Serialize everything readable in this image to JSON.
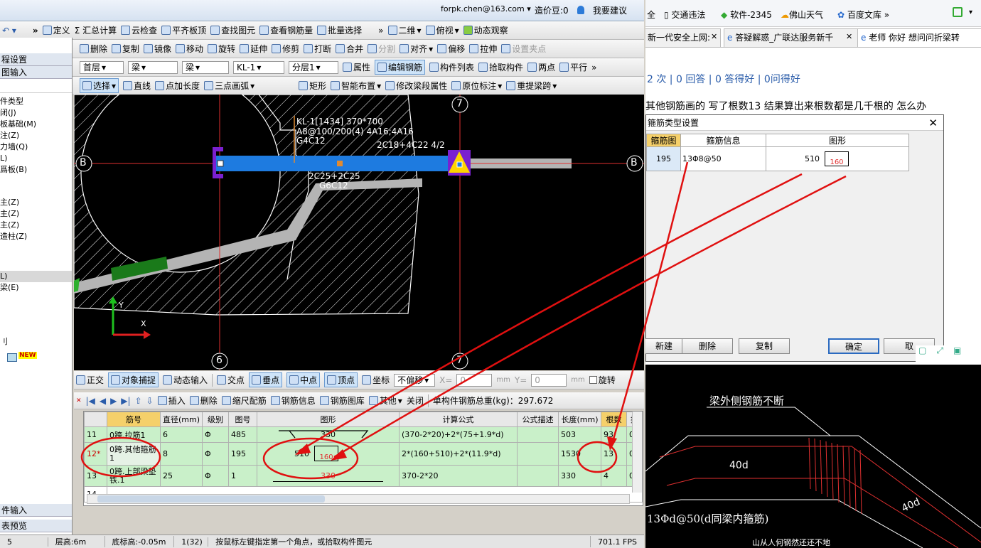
{
  "app": {
    "user": "forpk.chen@163.com",
    "cost_beans": "造价豆:0",
    "suggest": "我要建议"
  },
  "toolbar1": [
    "定义",
    "Σ 汇总计算",
    "云检查",
    "平齐板顶",
    "查找图元",
    "查看钢筋量",
    "批量选择"
  ],
  "view_bar": {
    "mode": "二维",
    "view": "俯视",
    "dynamic": "动态观察"
  },
  "toolbar2": [
    "删除",
    "复制",
    "镜像",
    "移动",
    "旋转",
    "延伸",
    "修剪",
    "打断",
    "合并",
    "分割",
    "对齐",
    "偏移",
    "拉伸",
    "设置夹点"
  ],
  "toolbar3": {
    "floor": "首层",
    "type1": "梁",
    "type2": "梁",
    "member": "KL-1",
    "layer": "分层1",
    "buttons": [
      "属性",
      "编辑钢筋",
      "构件列表",
      "拾取构件",
      "两点",
      "平行"
    ]
  },
  "toolbar4": [
    "选择",
    "直线",
    "点加长度",
    "三点画弧",
    "矩形",
    "智能布置",
    "修改梁段属性",
    "原位标注",
    "重提梁跨"
  ],
  "left_panel": {
    "header1": "程设置",
    "header2": "图输入",
    "items": [
      "件类型",
      "闭(J)",
      "板基础(M)",
      "注(Z)",
      "力墙(Q)",
      "L)",
      "爲板(B)",
      "主(Z)",
      "主(Z)",
      "主(Z)",
      "造柱(Z)",
      "L)",
      "梁(E)",
      "刂"
    ],
    "new_badge": "NEW",
    "footer1": "件输入",
    "footer2": "表预览"
  },
  "canvas": {
    "grid_labels": [
      "B",
      "B",
      "7",
      "7",
      "6",
      "7"
    ],
    "beam_text": [
      "KL-1[1434] 370*700",
      "A8@100/200(4) 4A16;4A16",
      "G4C12",
      "2C18+4C22 4/2",
      "2C25+2C25",
      "G6C12"
    ],
    "axis_y": "Y",
    "axis_x": "X"
  },
  "snap_bar": [
    "正交",
    "对象捕捉",
    "动态输入",
    "交点",
    "垂点",
    "中点",
    "顶点",
    "坐标",
    "不偏移",
    "X=",
    "0",
    "mm",
    "Y=",
    "0",
    "mm",
    "旋转"
  ],
  "rebar_bar": {
    "buttons": [
      "插入",
      "删除",
      "缩尺配筋",
      "钢筋信息",
      "钢筋图库",
      "其他",
      "关闭"
    ],
    "total": "单构件钢筋总重(kg)：297.672"
  },
  "table": {
    "headers": [
      "筋号",
      "直径(mm)",
      "级别",
      "图号",
      "图形",
      "计算公式",
      "公式描述",
      "长度(mm)",
      "根数",
      "搭"
    ],
    "rows": [
      {
        "no": "11",
        "name": "0跨.拉筋1",
        "dia": "6",
        "grade": "Φ",
        "fig": "485",
        "shape": "330",
        "formula": "(370-2*20)+2*(75+1.9*d)",
        "desc": "",
        "len": "503",
        "count": "93",
        "lap": "0"
      },
      {
        "no": "12*",
        "name": "0跨.其他箍筋1",
        "dia": "8",
        "grade": "Φ",
        "fig": "195",
        "shape_a": "510",
        "shape_b": "160",
        "formula": "2*(160+510)+2*(11.9*d)",
        "desc": "",
        "len": "1530",
        "count": "13",
        "lap": "0"
      },
      {
        "no": "13",
        "name": "0跨.上部梁垫铁.1",
        "dia": "25",
        "grade": "Φ",
        "fig": "1",
        "shape": "330",
        "formula": "370-2*20",
        "desc": "",
        "len": "330",
        "count": "4",
        "lap": "0"
      },
      {
        "no": "14",
        "name": "",
        "dia": "",
        "grade": "",
        "fig": "",
        "shape": "",
        "formula": "",
        "desc": "",
        "len": "",
        "count": "",
        "lap": ""
      }
    ]
  },
  "status": {
    "floor_h": "层高:6m",
    "bottom": "底标高:-0.05m",
    "sel": "1(32)",
    "hint": "按鼠标左键指定第一个角点，或拾取构件图元",
    "fps": "701.1 FPS",
    "left": "5"
  },
  "browser": {
    "bookmarks": [
      "全",
      "交通违法",
      "软件-2345",
      "佛山天气",
      "百度文库"
    ],
    "tabs": [
      "新一代安全上网:",
      "答疑解惑_广联达服务新千",
      "老师 你好 想问问折梁转"
    ],
    "stats": "2 次 | 0 回答 | 0 答得好 | 0问得好",
    "question": "其他钢筋画的  写了根数13  结果算出来根数都是几千根的  怎么办"
  },
  "dialog": {
    "title": "箍筋类型设置",
    "headers": [
      "箍筋图号",
      "箍筋信息",
      "图形"
    ],
    "row": {
      "fig": "195",
      "info": "13Φ8@50",
      "a": "510",
      "b": "160"
    },
    "buttons": [
      "新建",
      "删除",
      "复制",
      "确定",
      "取"
    ]
  },
  "drawing": {
    "label1": "梁外侧钢筋不断",
    "label2": "40d",
    "label3": "40d",
    "label4": "13Φd@50(d同梁内箍筋)",
    "label5": "山从人何钢然还还不地"
  }
}
